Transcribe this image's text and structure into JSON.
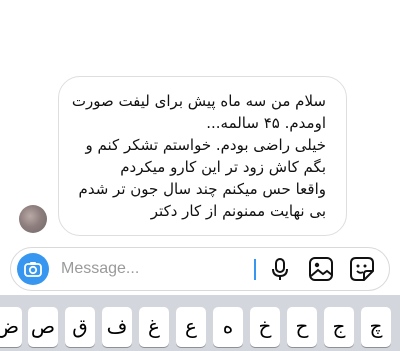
{
  "message": {
    "lines": [
      "سلام من سه ماه  پیش برای لیفت صورت",
      "اومدم. ۴۵ سالمه...",
      "خیلی راضی بودم. خواستم تشکر کنم و",
      "بگم کاش زود تر این کارو میکردم",
      "واقعا حس میکنم چند سال جون تر شدم",
      "بی نهایت ممنونم از کار دکتر"
    ]
  },
  "composer": {
    "placeholder": "Message...",
    "icons": [
      "camera-icon",
      "microphone-icon",
      "gallery-icon",
      "sticker-icon"
    ],
    "accent_color": "#3797f0"
  },
  "keyboard": {
    "keys": [
      "ض",
      "ص",
      "ق",
      "ف",
      "غ",
      "ع",
      "ه",
      "خ",
      "ح",
      "ج",
      "چ"
    ]
  }
}
